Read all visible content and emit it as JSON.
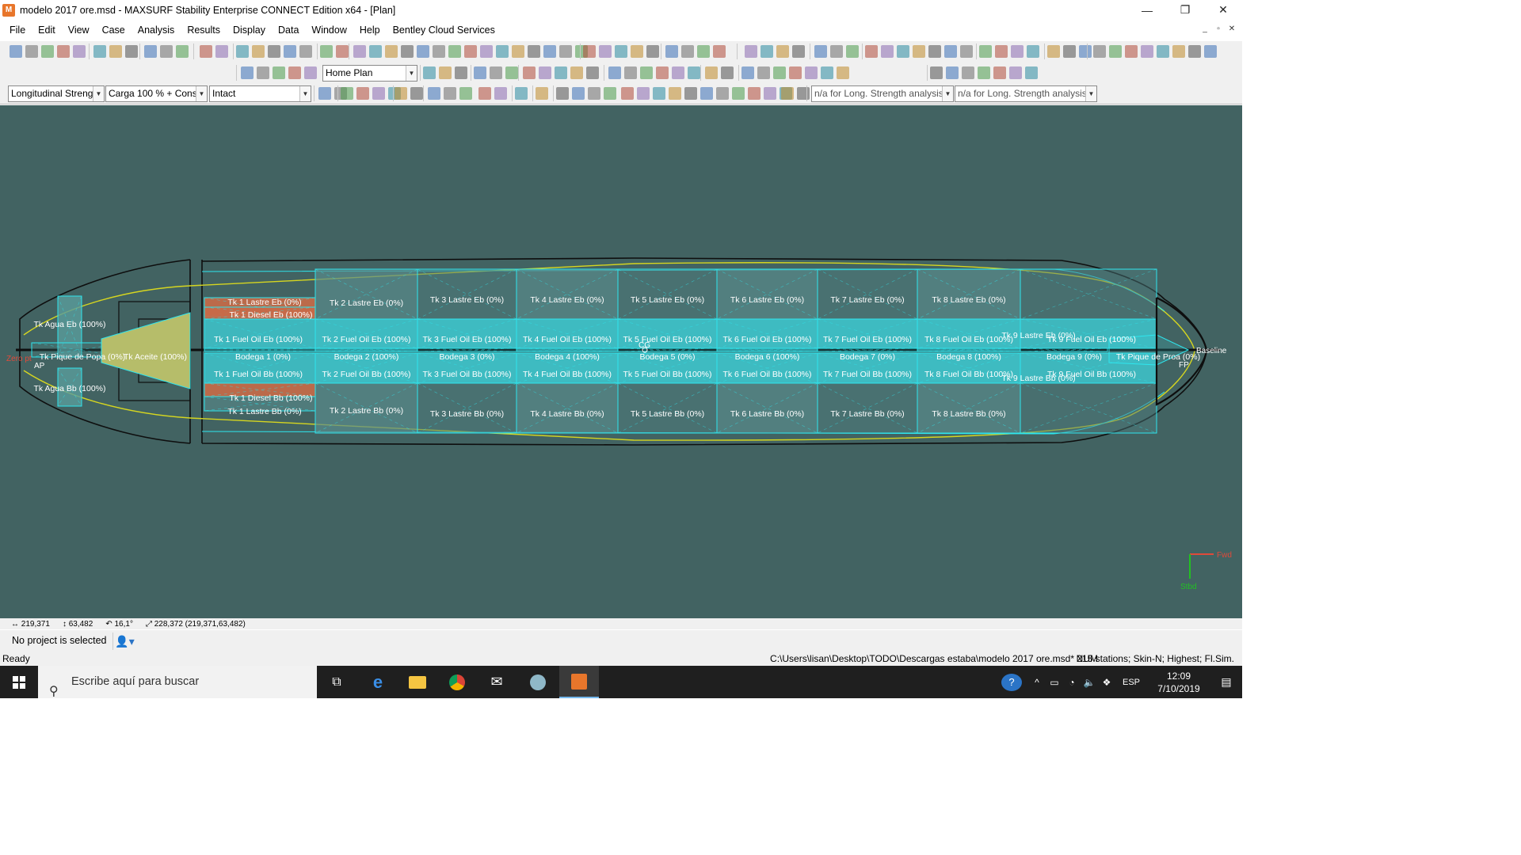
{
  "window": {
    "title": "modelo 2017 ore.msd - MAXSURF Stability Enterprise CONNECT Edition x64 - [Plan]",
    "minimize": "—",
    "restore": "❐",
    "close": "✕"
  },
  "menu": [
    "File",
    "Edit",
    "View",
    "Case",
    "Analysis",
    "Results",
    "Display",
    "Data",
    "Window",
    "Help",
    "Bentley Cloud Services"
  ],
  "toolbar": {
    "view_select": "Home Plan",
    "analysis_type": "Longitudinal Streng",
    "loadcase": "Carga 100 % + Cons",
    "damage_case": "Intact",
    "la_combo_1": "n/a for Long. Strength analysis",
    "la_combo_2": "n/a for Long. Strength analysis"
  },
  "plan": {
    "tanks": [
      {
        "name": "Tk Agua Eb (100%)"
      },
      {
        "name": "Tk Agua Bb (100%)"
      },
      {
        "name": "Tk Pique de Popa (0%)"
      },
      {
        "name": "Tk Aceite (100%)"
      },
      {
        "name": "Tk 1 Lastre Eb (0%)"
      },
      {
        "name": "Tk 1 Diesel Eb (100%)"
      },
      {
        "name": "Tk 1 Fuel Oil Eb (100%)"
      },
      {
        "name": "Bodega 1 (0%)"
      },
      {
        "name": "Tk 1 Fuel Oil Bb (100%)"
      },
      {
        "name": "Tk 1 Diesel Bb (100%)"
      },
      {
        "name": "Tk 1 Lastre Bb (0%)"
      },
      {
        "name": "Tk 2 Lastre Eb (0%)"
      },
      {
        "name": "Tk 2 Fuel Oil Eb (100%)"
      },
      {
        "name": "Bodega 2 (100%)"
      },
      {
        "name": "Tk 2 Fuel Oil Bb (100%)"
      },
      {
        "name": "Tk 2 Lastre Bb (0%)"
      },
      {
        "name": "Tk 3 Lastre Eb (0%)"
      },
      {
        "name": "Tk 3 Fuel Oil Eb (100%)"
      },
      {
        "name": "Bodega 3 (0%)"
      },
      {
        "name": "Tk 3 Fuel Oil Bb (100%)"
      },
      {
        "name": "Tk 3 Lastre Bb (0%)"
      },
      {
        "name": "Tk 4 Lastre Eb (0%)"
      },
      {
        "name": "Tk 4 Fuel Oil Eb (100%)"
      },
      {
        "name": "Bodega 4 (100%)"
      },
      {
        "name": "Tk 4 Fuel Oil Bb (100%)"
      },
      {
        "name": "Tk 4 Lastre Bb (0%)"
      },
      {
        "name": "Tk 5 Lastre Eb (0%)"
      },
      {
        "name": "Tk 5 Fuel Oil Eb (100%)"
      },
      {
        "name": "Bodega 5 (0%)"
      },
      {
        "name": "Tk 5 Fuel Oil Bb (100%)"
      },
      {
        "name": "Tk 5 Lastre Bb (0%)"
      },
      {
        "name": "Tk 6 Lastre Eb (0%)"
      },
      {
        "name": "Tk 6 Fuel Oil Eb (100%)"
      },
      {
        "name": "Bodega 6 (100%)"
      },
      {
        "name": "Tk 6 Fuel Oil Bb (100%)"
      },
      {
        "name": "Tk 6 Lastre Bb (0%)"
      },
      {
        "name": "Tk 7 Lastre Eb (0%)"
      },
      {
        "name": "Tk 7 Fuel Oil Eb (100%)"
      },
      {
        "name": "Bodega 7 (0%)"
      },
      {
        "name": "Tk 7 Fuel Oil Bb (100%)"
      },
      {
        "name": "Tk 7 Lastre Bb (0%)"
      },
      {
        "name": "Tk 8 Lastre Eb (0%)"
      },
      {
        "name": "Tk 8 Fuel Oil Eb (100%)"
      },
      {
        "name": "Bodega 8 (100%)"
      },
      {
        "name": "Tk 8 Fuel Oil Bb (100%)"
      },
      {
        "name": "Tk 8 Lastre Bb (0%)"
      },
      {
        "name": "Tk 9 Lastre Eb (0%)"
      },
      {
        "name": "Tk 9 Fuel Oil Eb (100%)"
      },
      {
        "name": "Bodega 9 (0%)"
      },
      {
        "name": "Tk 9 Fuel Oil Bb (100%)"
      },
      {
        "name": "Tk 9 Lastre Bb (0%)"
      },
      {
        "name": "Tk Pique de Proa (0%)"
      }
    ],
    "markers": {
      "zero_pt": "Zero pt",
      "ap": "AP",
      "fp": "FP",
      "cg": "CG",
      "baseline": "Baseline",
      "fwd": "Fwd",
      "stbd": "Stbd"
    },
    "colors": {
      "background": "#426362",
      "tank_outline": "#2ee6ee",
      "tank_full": "#3ed3dc",
      "tank_empty": "#5a8c8c",
      "diesel": "#c96a48",
      "oil": "#b6bd6a",
      "hull": "#0e0e0e",
      "waterline": "#d6d620"
    }
  },
  "coords": {
    "x": "219,371",
    "y": "63,482",
    "angle": "16,1°",
    "dist": "228,372 (219,371,63,482)"
  },
  "project": {
    "text": "No project is selected"
  },
  "status": {
    "ready": "Ready",
    "path": "C:\\Users\\lisan\\Desktop\\TODO\\Descargas estaba\\modelo 2017 ore.msd*",
    "num": "NUM",
    "stations": "215 stations; Skin-N; Highest; Fl.Sim."
  },
  "taskbar": {
    "search_placeholder": "Escribe aquí para buscar",
    "lang": "ESP",
    "time": "12:09",
    "date": "7/10/2019"
  }
}
